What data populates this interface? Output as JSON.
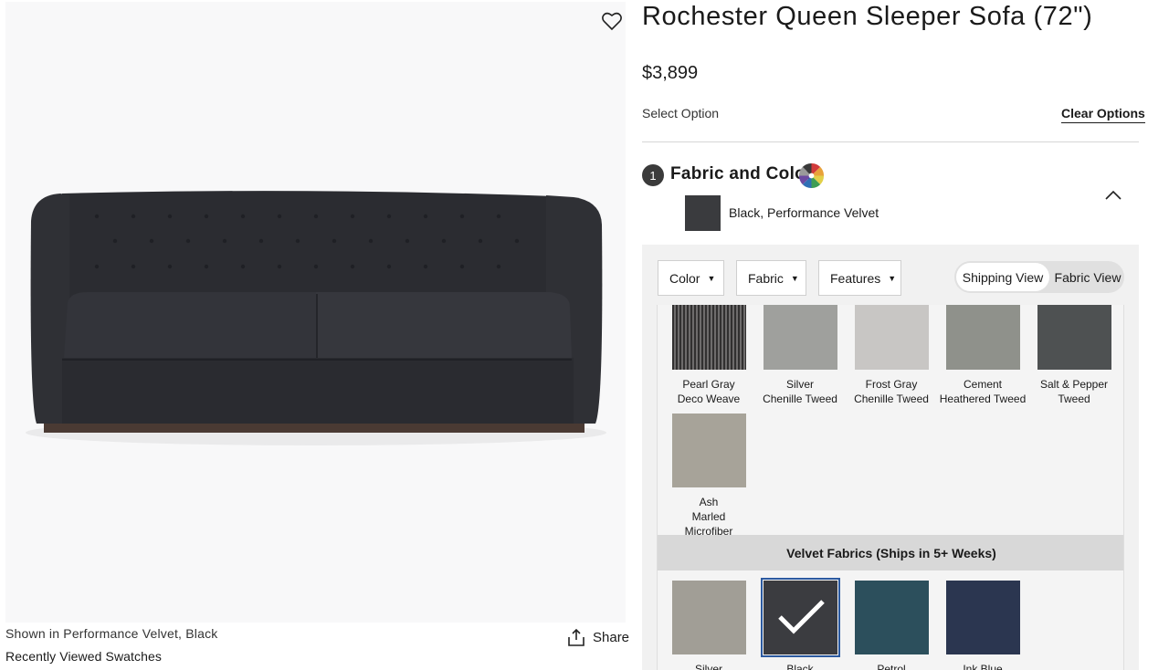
{
  "product": {
    "title": "Rochester Queen Sleeper Sofa (72\")",
    "price": "$3,899",
    "shown_in": "Shown in Performance Velvet, Black",
    "recently_viewed": "Recently Viewed Swatches",
    "share_label": "Share",
    "favorite_icon": "heart-outline-icon"
  },
  "options": {
    "select_option": "Select Option",
    "clear_options": "Clear Options"
  },
  "fabric_section": {
    "step_number": "1",
    "title": "Fabric and Color",
    "selected_name": "Black, Performance Velvet",
    "selected_color": "#3a3b3e",
    "filters": [
      {
        "label": "Color"
      },
      {
        "label": "Fabric"
      },
      {
        "label": "Features"
      }
    ],
    "view_toggle": {
      "shipping": "Shipping View",
      "fabric": "Fabric View",
      "active": "Shipping View"
    },
    "swatches_row1": [
      {
        "label_line1": "Pearl Gray",
        "label_line2": "Deco Weave",
        "color": "#8c8a8a"
      },
      {
        "label_line1": "Silver",
        "label_line2": "Chenille Tweed",
        "color": "#9fa09d"
      },
      {
        "label_line1": "Frost Gray",
        "label_line2": "Chenille Tweed",
        "color": "#c8c6c4"
      },
      {
        "label_line1": "Cement",
        "label_line2": "Heathered Tweed",
        "color": "#8f918b"
      },
      {
        "label_line1": "Salt & Pepper",
        "label_line2": "Tweed",
        "color": "#4e5152"
      }
    ],
    "swatches_row2": [
      {
        "label_line1": "Ash",
        "label_line2": "Marled",
        "label_line3": "Microfiber",
        "color": "#a7a399"
      }
    ],
    "velvet_group_title": "Velvet Fabrics (Ships in 5+ Weeks)",
    "velvet_swatches": [
      {
        "label": "Silver",
        "color": "#a19e96",
        "selected": false
      },
      {
        "label": "Black",
        "color": "#3b3c40",
        "selected": true
      },
      {
        "label": "Petrol",
        "color": "#2c4f5c",
        "selected": false
      },
      {
        "label": "Ink Blue",
        "color": "#2b3650",
        "selected": false
      }
    ]
  }
}
